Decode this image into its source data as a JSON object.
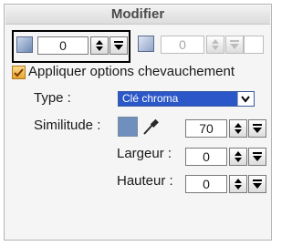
{
  "panel": {
    "title": "Modifier"
  },
  "layer": {
    "value": "0"
  },
  "secondary": {
    "value": "0"
  },
  "overlap": {
    "checkbox_label": "Appliquer options chevauchement"
  },
  "type": {
    "label": "Type :",
    "selected": "Clé chroma"
  },
  "similitude": {
    "label": "Similitude :",
    "value": "70"
  },
  "largeur": {
    "label": "Largeur :",
    "value": "0"
  },
  "hauteur": {
    "label": "Hauteur :",
    "value": "0"
  },
  "colors": {
    "checkbox": "#e8a530",
    "select_highlight": "#2b57c8",
    "swatch": "#6f8fbe"
  },
  "icons": [
    "layer-icon",
    "spin-up-icon",
    "spin-down-icon",
    "checkmark-icon",
    "dropdown-arrow-icon",
    "eyedropper-icon"
  ]
}
